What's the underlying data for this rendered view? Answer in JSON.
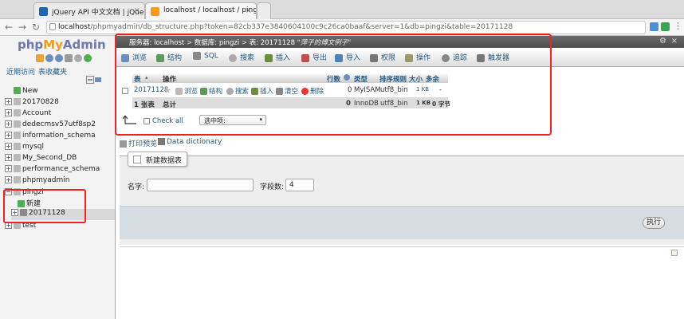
{
  "browser": {
    "tabs": [
      {
        "title": "jQuery API 中文文档 | jQuery A"
      },
      {
        "title": "localhost / localhost / pingzi / "
      }
    ],
    "url_host": "localhost",
    "url_rest": "/phpmyadmin/db_structure.php?token=82cb337e3840604100c9c26ca0baaf&server=1&db=pingzi&table=20171128"
  },
  "sidebar": {
    "logo_php": "php",
    "logo_my": "My",
    "logo_admin": "Admin",
    "recent": "近期访问",
    "favorites": "表收藏夹",
    "tree": [
      {
        "label": "New"
      },
      {
        "label": "20170828"
      },
      {
        "label": "Account"
      },
      {
        "label": "dedecmsv57utf8sp2"
      },
      {
        "label": "information_schema"
      },
      {
        "label": "mysql"
      },
      {
        "label": "My_Second_DB"
      },
      {
        "label": "performance_schema"
      },
      {
        "label": "phpmyadmin"
      },
      {
        "label": "pingzi"
      },
      {
        "label": "新建"
      },
      {
        "label": "20171128"
      },
      {
        "label": "test"
      }
    ]
  },
  "breadcrumb": {
    "server": "服务器: localhost",
    "db": "数据库: pingzi",
    "table": "表: 20171128",
    "comment": "\"萍子的博文例子\""
  },
  "menu": [
    "浏览",
    "结构",
    "SQL",
    "搜索",
    "插入",
    "导出",
    "导入",
    "权限",
    "操作",
    "追踪",
    "触发器"
  ],
  "table": {
    "headers": {
      "table": "表",
      "action": "操作",
      "rows": "行数",
      "type": "类型",
      "collation": "排序规则",
      "size": "大小",
      "overhead": "多余"
    },
    "row": {
      "name": "20171128",
      "actions": [
        "浏览",
        "结构",
        "搜索",
        "插入",
        "清空",
        "删除"
      ],
      "rows": "0",
      "type": "MyISAM",
      "collation": "utf8_bin",
      "size": "1 KB",
      "overhead": "-"
    },
    "summary": {
      "count": "1 张表",
      "label": "总计",
      "rows": "0",
      "type": "InnoDB",
      "collation": "utf8_bin",
      "size": "1 KB",
      "overhead": "0 字节"
    },
    "check_all": "Check all",
    "with_selected": "选中项:"
  },
  "links": {
    "print": "打印预览",
    "dictionary": "Data dictionary"
  },
  "create_table": {
    "legend": "新建数据表",
    "name_label": "名字:",
    "name_value": "",
    "cols_label": "字段数:",
    "cols_value": "4",
    "go": "执行"
  }
}
